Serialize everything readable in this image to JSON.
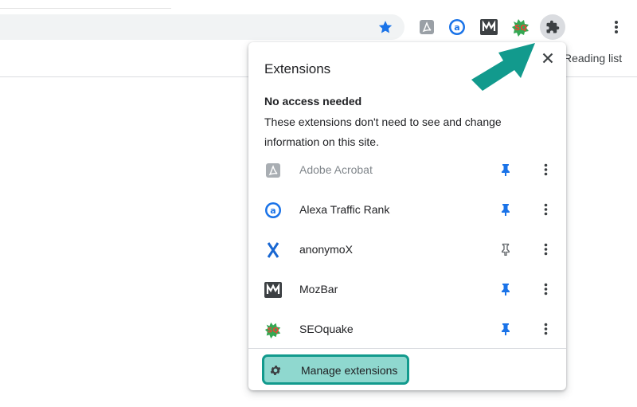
{
  "toolbar": {
    "reading_list_label": "Reading list"
  },
  "popup": {
    "title": "Extensions",
    "section_heading": "No access needed",
    "section_description": "These extensions don't need to see and change information on this site.",
    "extensions": [
      {
        "name": "Adobe Acrobat",
        "icon": "adobe-acrobat-icon",
        "pinned": true,
        "enabled": false
      },
      {
        "name": "Alexa Traffic Rank",
        "icon": "alexa-icon",
        "pinned": true,
        "enabled": true
      },
      {
        "name": "anonymoX",
        "icon": "anonymox-icon",
        "pinned": false,
        "enabled": true
      },
      {
        "name": "MozBar",
        "icon": "mozbar-icon",
        "pinned": true,
        "enabled": true
      },
      {
        "name": "SEOquake",
        "icon": "seoquake-icon",
        "pinned": true,
        "enabled": true
      }
    ],
    "manage_label": "Manage extensions"
  },
  "colors": {
    "accent_blue": "#1a73e8",
    "highlight_teal": "#129a8d",
    "highlight_fill": "#8fd8cf"
  }
}
